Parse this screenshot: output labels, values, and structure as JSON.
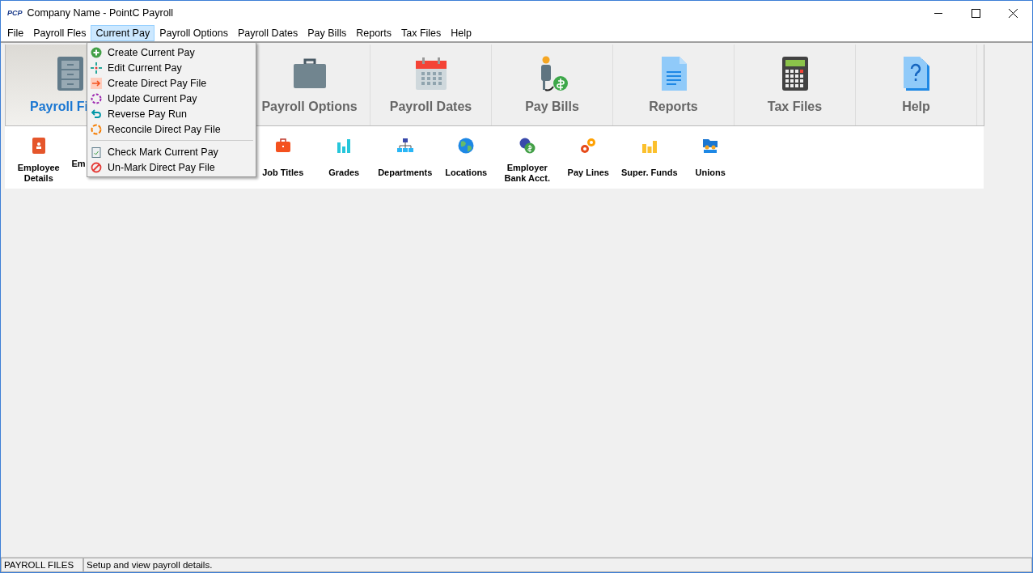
{
  "window": {
    "logo": "PCP",
    "title": "Company Name - PointC Payroll"
  },
  "menu_bar": [
    {
      "label": "File",
      "selected": false
    },
    {
      "label": "Payroll Fles",
      "selected": false
    },
    {
      "label": "Current Pay",
      "selected": true
    },
    {
      "label": "Payroll Options",
      "selected": false
    },
    {
      "label": "Payroll Dates",
      "selected": false
    },
    {
      "label": "Pay Bills",
      "selected": false
    },
    {
      "label": "Reports",
      "selected": false
    },
    {
      "label": "Tax Files",
      "selected": false
    },
    {
      "label": "Help",
      "selected": false
    }
  ],
  "dropdown": {
    "groups": [
      [
        "Create Current Pay",
        "Edit Current Pay",
        "Create Direct Pay File",
        "Update Current Pay",
        "Reverse Pay Run",
        "Reconcile Direct Pay File"
      ],
      [
        "Check Mark Current Pay",
        "Un-Mark Direct Pay File"
      ]
    ]
  },
  "ribbon": [
    {
      "label": "Payroll Fi",
      "selected": true
    },
    {
      "label": "Payroll Options",
      "selected": false
    },
    {
      "label": "Payroll Dates",
      "selected": false
    },
    {
      "label": "Pay Bills",
      "selected": false
    },
    {
      "label": "Reports",
      "selected": false
    },
    {
      "label": "Tax Files",
      "selected": false
    },
    {
      "label": "Help",
      "selected": false
    }
  ],
  "toolbar": [
    {
      "lines": [
        "Employee",
        "Details"
      ]
    },
    {
      "lines": [
        "Em"
      ]
    },
    {
      "lines": [
        "Job Titles"
      ]
    },
    {
      "lines": [
        "Grades"
      ]
    },
    {
      "lines": [
        "Departments"
      ]
    },
    {
      "lines": [
        "Locations"
      ]
    },
    {
      "lines": [
        "Employer",
        "Bank Acct."
      ]
    },
    {
      "lines": [
        "Pay Lines"
      ]
    },
    {
      "lines": [
        "Super. Funds"
      ]
    },
    {
      "lines": [
        "Unions"
      ]
    }
  ],
  "status_bar": {
    "section": "PAYROLL FILES",
    "message": "Setup and view payroll details."
  }
}
